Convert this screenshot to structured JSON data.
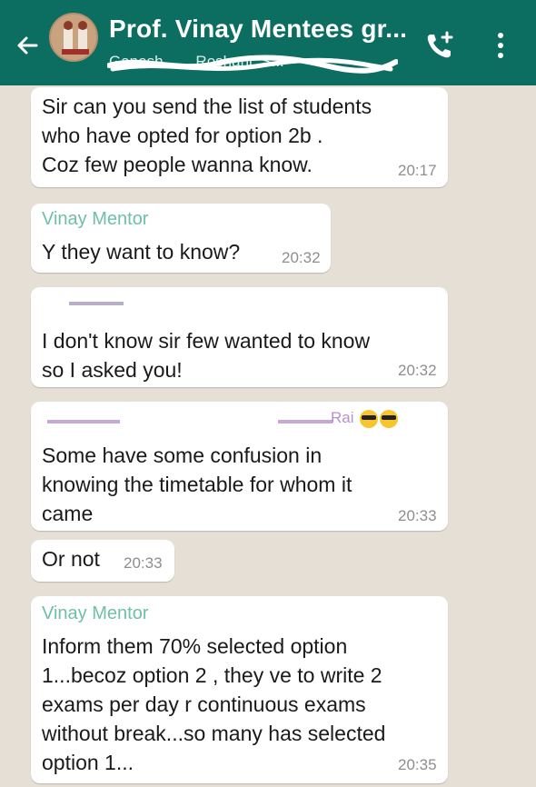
{
  "header": {
    "title": "Prof. Vinay Mentees gr...",
    "subtitle": "Ganesh, …, Roshani, S..."
  },
  "messages": [
    {
      "sender": "",
      "lines": [
        "Sir can you send the list of students",
        "who have opted for option 2b .",
        "Coz few people wanna know."
      ],
      "time": "20:17"
    },
    {
      "sender": "Vinay Mentor",
      "lines": [
        "Y they want to know?"
      ],
      "time": "20:32"
    },
    {
      "sender": "",
      "lines": [
        "I don't know sir few wanted to know",
        "so I asked you!"
      ],
      "time": "20:32"
    },
    {
      "sender": "Rai",
      "lines": [
        "Some have some confusion in",
        "knowing the timetable for whom it",
        "came"
      ],
      "time": "20:33"
    },
    {
      "sender": "",
      "lines": [
        "Or not"
      ],
      "time": "20:33"
    },
    {
      "sender": "Vinay Mentor",
      "lines": [
        "Inform them 70% selected option",
        "1...becoz option 2 , they ve to write 2",
        "exams per day r continuous exams",
        "without break...so many has selected",
        "option 1..."
      ],
      "time": "20:35"
    }
  ],
  "colors": {
    "header": "#0b6e61",
    "sender_name": "#6fc0a6",
    "chat_bg": "#e6dfd6"
  },
  "icons": [
    "back-arrow-icon",
    "group-avatar",
    "add-call-icon",
    "overflow-menu-icon",
    "sunglasses-emoji-icon"
  ]
}
